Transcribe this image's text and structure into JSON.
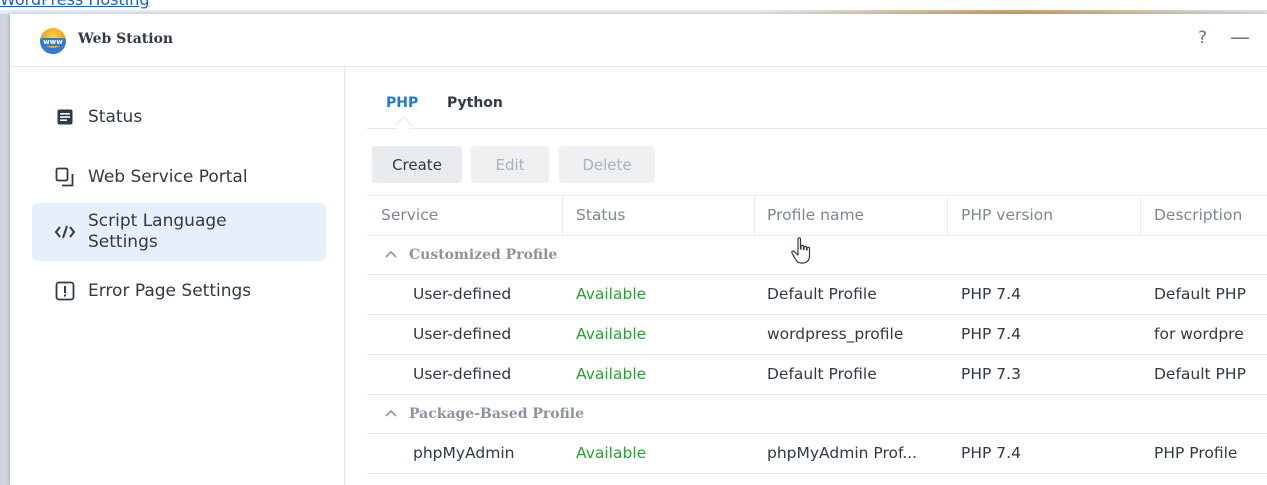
{
  "background": {
    "link_text": "WordPress Hosting"
  },
  "window": {
    "title": "Web Station",
    "app_icon_text": "www",
    "help_label": "?",
    "minimize_label": "—"
  },
  "sidebar": {
    "items": [
      {
        "label": "Status",
        "icon": "document-icon",
        "icon_glyph": "▤",
        "active": false
      },
      {
        "label": "Web Service Portal",
        "icon": "portal-icon",
        "icon_glyph": "⧉",
        "active": false
      },
      {
        "label": "Script Language Settings",
        "icon": "code-icon",
        "icon_glyph": "‹/›",
        "active": true
      },
      {
        "label": "Error Page Settings",
        "icon": "exclamation-icon",
        "icon_glyph": "!",
        "active": false
      }
    ]
  },
  "tabs": [
    {
      "label": "PHP",
      "active": true
    },
    {
      "label": "Python",
      "active": false
    }
  ],
  "toolbar": {
    "create_label": "Create",
    "edit_label": "Edit",
    "delete_label": "Delete"
  },
  "table": {
    "columns": [
      "Service",
      "Status",
      "Profile name",
      "PHP version",
      "Description"
    ],
    "groups": [
      {
        "label": "Customized Profile",
        "rows": [
          {
            "service": "User-defined",
            "status": "Available",
            "profile": "Default Profile",
            "php": "PHP 7.4",
            "description": "Default PHP"
          },
          {
            "service": "User-defined",
            "status": "Available",
            "profile": "wordpress_profile",
            "php": "PHP 7.4",
            "description": "for wordpre"
          },
          {
            "service": "User-defined",
            "status": "Available",
            "profile": "Default Profile",
            "php": "PHP 7.3",
            "description": "Default PHP"
          }
        ]
      },
      {
        "label": "Package-Based Profile",
        "rows": [
          {
            "service": "phpMyAdmin",
            "status": "Available",
            "profile": "phpMyAdmin Prof...",
            "php": "PHP 7.4",
            "description": "PHP Profile"
          }
        ]
      }
    ],
    "group_caret": "^"
  },
  "colors": {
    "accent": "#1f7ad6",
    "available": "#25a32f",
    "active_nav_bg": "#e6f0fb"
  }
}
